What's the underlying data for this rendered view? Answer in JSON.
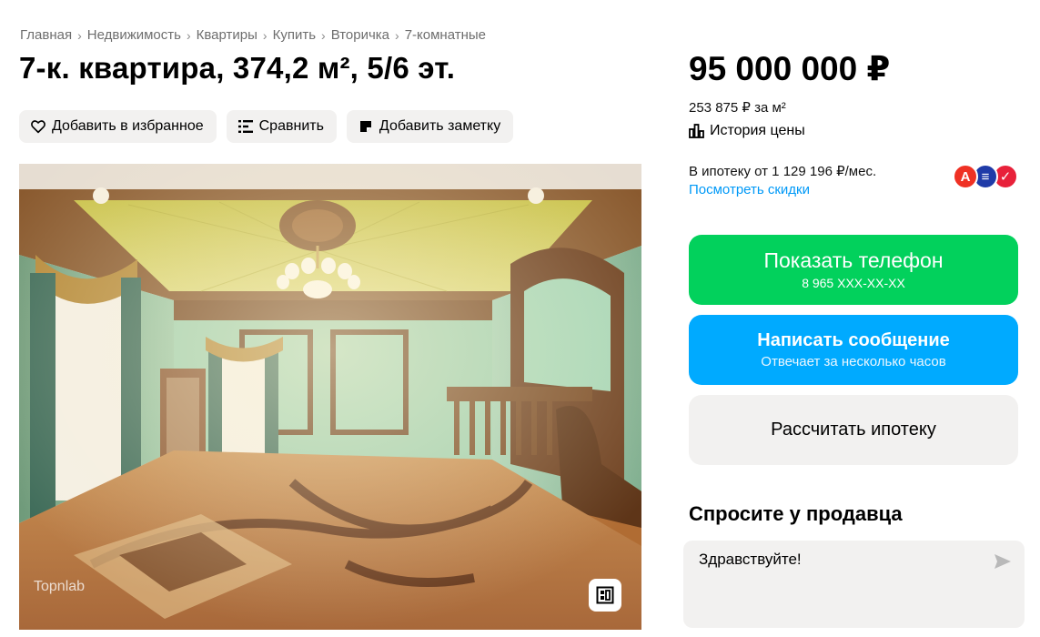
{
  "breadcrumbs": [
    {
      "label": "Главная"
    },
    {
      "label": "Недвижимость"
    },
    {
      "label": "Квартиры"
    },
    {
      "label": "Купить"
    },
    {
      "label": "Вторичка"
    },
    {
      "label": "7-комнатные"
    }
  ],
  "breadcrumb_separator": "›",
  "title": "7-к. квартира, 374,2 м², 5/6 эт.",
  "actions": {
    "favorite": {
      "label": "Добавить в избранное",
      "icon": "heart-icon"
    },
    "compare": {
      "label": "Сравнить",
      "icon": "compare-icon"
    },
    "note": {
      "label": "Добавить заметку",
      "icon": "note-icon"
    }
  },
  "photo": {
    "watermark": "Topnlab",
    "gallery_icon": "gallery-icon"
  },
  "sidebar": {
    "price": "95 000 000 ₽",
    "price_per_m2": "253 875 ₽ за м²",
    "price_history": {
      "label": "История цены",
      "icon": "chart-icon"
    },
    "mortgage": {
      "text": "В ипотеку от 1 129 196 ₽/мес.",
      "discounts_link": "Посмотреть скидки",
      "banks": [
        {
          "letter": "А",
          "color": "#ef3124"
        },
        {
          "letter": "≡",
          "color": "#1f3ba8"
        },
        {
          "letter": "✓",
          "color": "#e8213a"
        }
      ]
    },
    "show_phone": {
      "label": "Показать телефон",
      "phone": "8 965 XXX-XX-XX",
      "color": "#02d15c"
    },
    "message": {
      "label": "Написать сообщение",
      "subtitle": "Отвечает за несколько часов",
      "color": "#00aaff"
    },
    "mortgage_calc": {
      "label": "Рассчитать ипотеку"
    },
    "ask_seller": {
      "title": "Спросите у продавца",
      "message": "Здравствуйте!",
      "send_icon": "send-icon"
    }
  }
}
